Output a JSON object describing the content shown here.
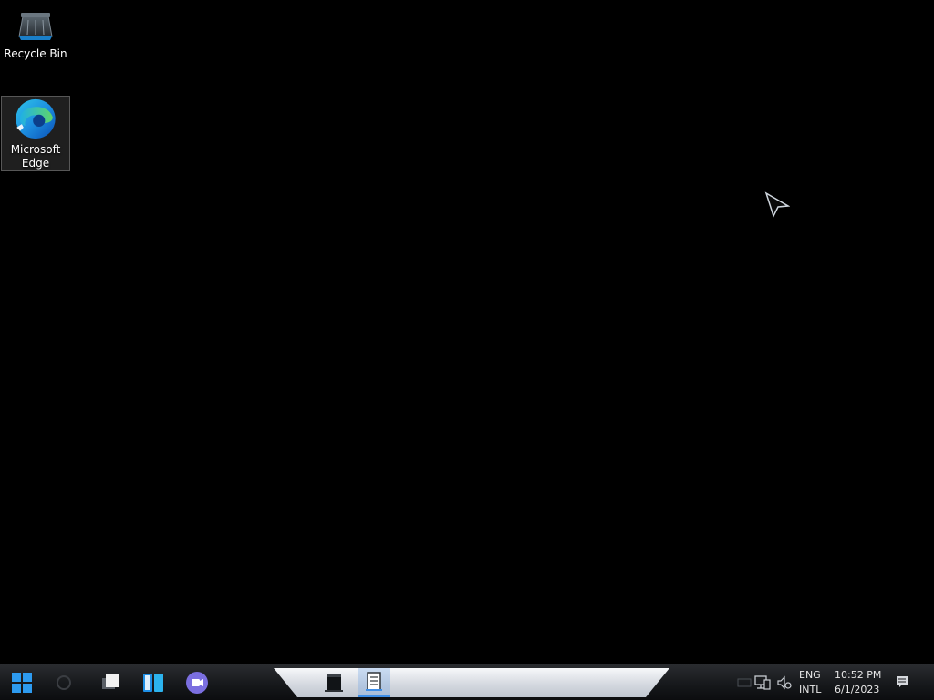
{
  "desktop": {
    "icons": [
      {
        "label": "Recycle Bin",
        "icon": "recycle-bin-icon"
      },
      {
        "label": "Microsoft Edge",
        "icon": "edge-icon",
        "selected": true
      }
    ]
  },
  "taskbar": {
    "start": {
      "icon": "windows-start-icon",
      "color": "#2d9bf0"
    },
    "items": [
      {
        "icon": "search-icon"
      },
      {
        "icon": "task-view-icon"
      },
      {
        "icon": "widgets-icon"
      },
      {
        "icon": "teams-chat-icon",
        "color": "#7b6fe0"
      },
      {
        "icon": "app-window-icon"
      },
      {
        "icon": "notepad-icon",
        "active": true
      }
    ],
    "tray": {
      "icons": [
        "hidden-icons-chevron-icon",
        "network-icon",
        "volume-icon"
      ],
      "language": {
        "line1": "ENG",
        "line2": "INTL"
      },
      "clock": {
        "time": "10:52 PM",
        "date": "6/1/2023"
      },
      "notifications_icon": "notification-icon"
    }
  }
}
